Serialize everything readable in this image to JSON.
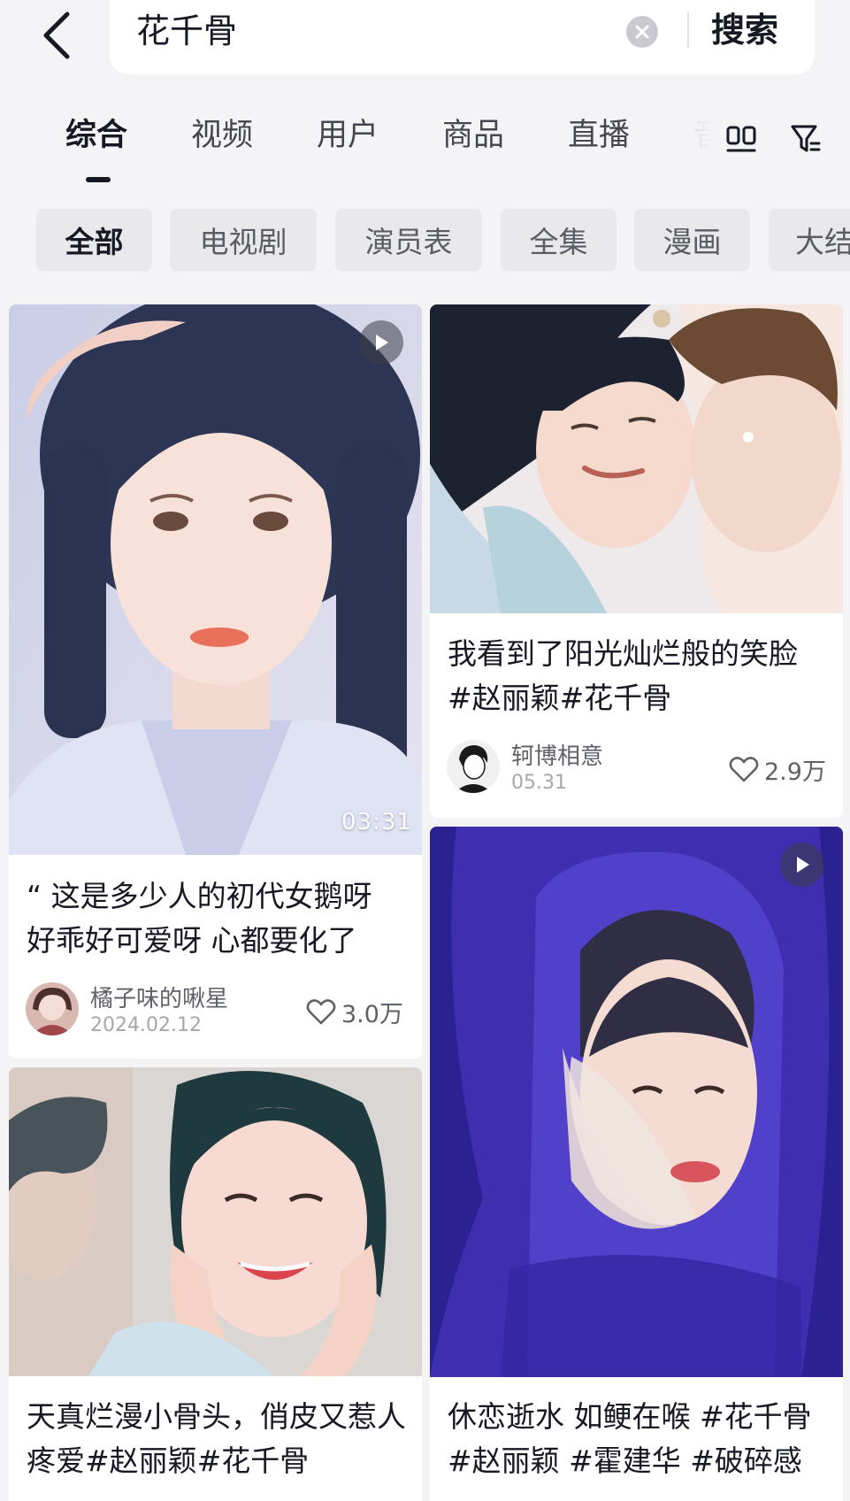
{
  "search": {
    "query": "花千骨",
    "search_label": "搜索"
  },
  "tabs": [
    {
      "label": "综合"
    },
    {
      "label": "视频"
    },
    {
      "label": "用户"
    },
    {
      "label": "商品"
    },
    {
      "label": "直播"
    },
    {
      "label": "音"
    }
  ],
  "chips": [
    {
      "label": "全部"
    },
    {
      "label": "电视剧"
    },
    {
      "label": "演员表"
    },
    {
      "label": "全集"
    },
    {
      "label": "漫画"
    },
    {
      "label": "大结"
    }
  ],
  "posts": [
    {
      "title": "“ 这是多少人的初代女鹅呀 好乖好可爱呀 心都要化了",
      "author": "橘子味的啾星",
      "date": "2024.02.12",
      "likes": "3.0万",
      "duration": "03:31"
    },
    {
      "title": "我看到了阳光灿烂般的笑脸 #赵丽颖#花千骨",
      "author": "轲博相意",
      "date": "05.31",
      "likes": "2.9万"
    },
    {
      "title": "天真烂漫小骨头，俏皮又惹人疼爱#赵丽颖#花千骨"
    },
    {
      "title": "休恋逝水 如鲠在喉 #花千骨 #赵丽颖 #霍建华 #破碎感"
    }
  ]
}
